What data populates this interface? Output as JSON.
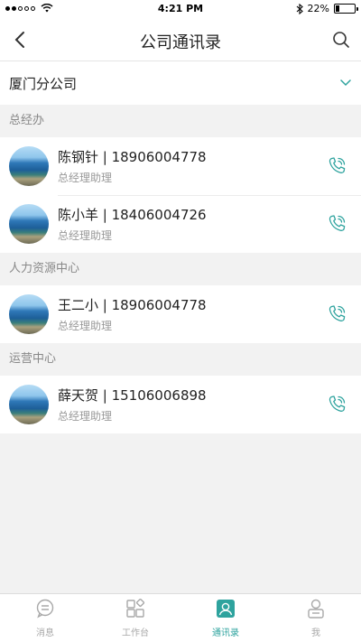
{
  "status_bar": {
    "time": "4:21 PM",
    "battery": "22%",
    "battery_level": 0.22
  },
  "nav": {
    "title": "公司通讯录"
  },
  "company": {
    "name": "厦门分公司"
  },
  "groups": [
    {
      "name": "总经办",
      "contacts": [
        {
          "name_phone": "陈钢针 | 18906004778",
          "role": "总经理助理"
        },
        {
          "name_phone": "陈小羊 | 18406004726",
          "role": "总经理助理"
        }
      ]
    },
    {
      "name": "人力资源中心",
      "contacts": [
        {
          "name_phone": "王二小 | 18906004778",
          "role": "总经理助理"
        }
      ]
    },
    {
      "name": "运营中心",
      "contacts": [
        {
          "name_phone": "薛天贺 | 15106006898",
          "role": "总经理助理"
        }
      ]
    }
  ],
  "tabs": [
    {
      "label": "消息",
      "icon": "message-icon",
      "active": false
    },
    {
      "label": "工作台",
      "icon": "workbench-icon",
      "active": false
    },
    {
      "label": "通讯录",
      "icon": "contacts-icon",
      "active": true
    },
    {
      "label": "我",
      "icon": "profile-icon",
      "active": false
    }
  ],
  "colors": {
    "accent": "#2ea39e",
    "inactive": "#a8a8a8"
  }
}
